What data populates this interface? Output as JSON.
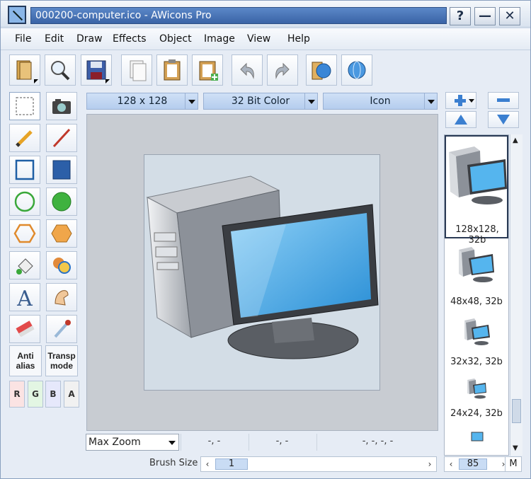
{
  "window": {
    "title": "000200-computer.ico - AWicons Pro",
    "title_buttons": [
      "?",
      "—",
      "✕"
    ]
  },
  "menu": [
    "File",
    "Edit",
    "Draw",
    "Effects",
    "Object",
    "Image",
    "View",
    "Help"
  ],
  "toolbar": {
    "tools": [
      {
        "name": "open-icon",
        "glyph": "📂"
      },
      {
        "name": "zoom-icon",
        "glyph": "🔍"
      },
      {
        "name": "save-icon",
        "glyph": "💾"
      },
      {
        "name": "copy-icon",
        "glyph": "📄"
      },
      {
        "name": "paste-icon",
        "glyph": "📋"
      },
      {
        "name": "paste-new-icon",
        "glyph": "📋"
      },
      {
        "name": "undo-icon",
        "glyph": "↶"
      },
      {
        "name": "redo-icon",
        "glyph": "↷"
      },
      {
        "name": "globe-book-icon",
        "glyph": "🌐"
      },
      {
        "name": "globe-icon",
        "glyph": "🌍"
      }
    ]
  },
  "combos": {
    "size": "128 x 128",
    "color": "32 Bit Color",
    "type": "Icon"
  },
  "palette": {
    "anti_alias": "Anti\nalias",
    "transp_mode": "Transp\nmode",
    "channels": [
      "R",
      "G",
      "B",
      "A"
    ]
  },
  "status": {
    "zoom": "Max Zoom",
    "cell1": "-, -",
    "cell2": "-, -",
    "cell3": "-, -, -, -",
    "brush_label": "Brush Size",
    "brush_value": "1",
    "list_value": "85",
    "list_mode": "M"
  },
  "formats": [
    {
      "label": "128x128, 32b",
      "selected": true
    },
    {
      "label": "48x48, 32b",
      "selected": false
    },
    {
      "label": "32x32, 32b",
      "selected": false
    },
    {
      "label": "24x24, 32b",
      "selected": false
    }
  ],
  "colors": {
    "accent": "#3a63a6",
    "combo": "#bfd4f1",
    "canvas": "#c8ccd2"
  }
}
